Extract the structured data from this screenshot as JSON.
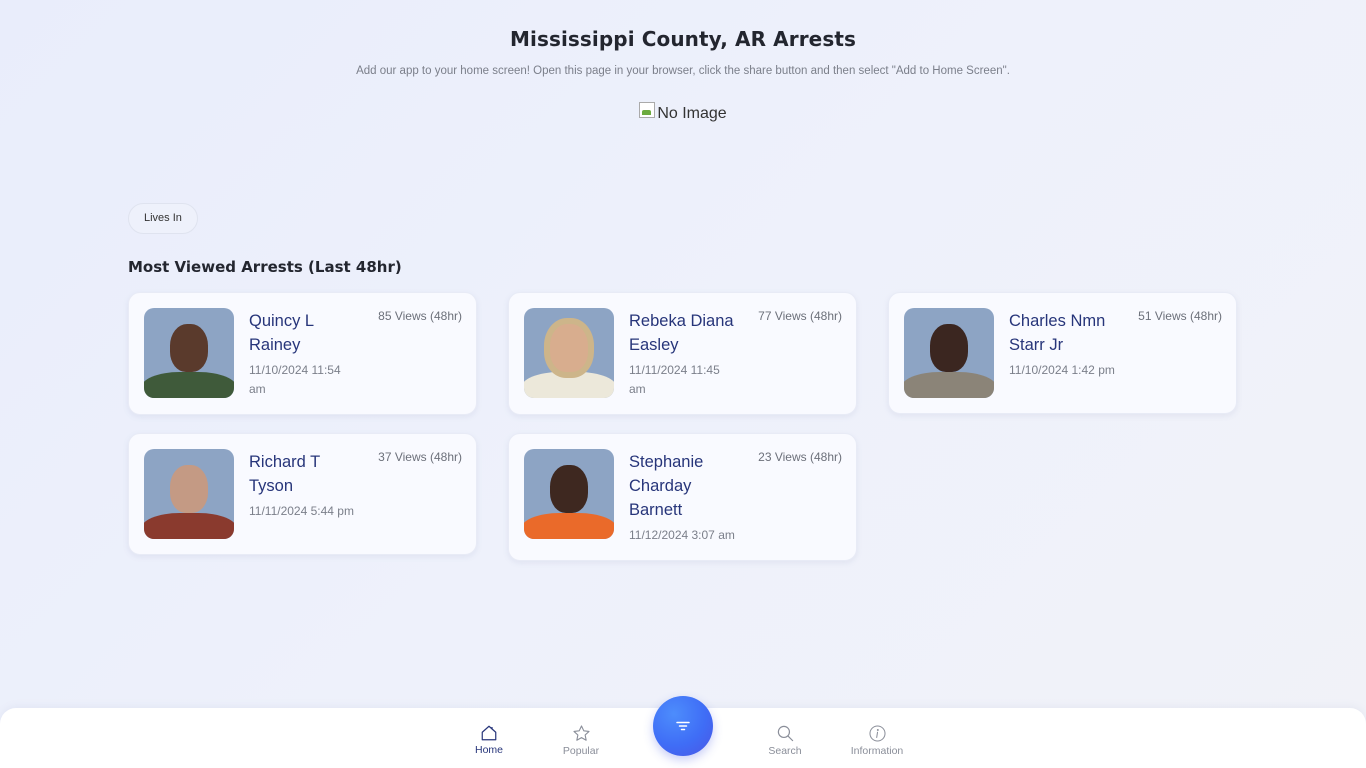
{
  "header": {
    "title": "Mississippi County, AR Arrests",
    "subtitle": "Add our app to your home screen! Open this page in your browser, click the share button and then select \"Add to Home Screen\".",
    "image_alt": "No Image"
  },
  "filters": {
    "chip_label": "Lives In"
  },
  "section": {
    "title": "Most Viewed Arrests (Last 48hr)"
  },
  "arrests": [
    {
      "name": "Quincy L Rainey",
      "datetime": "11/10/2024 11:54 am",
      "views": "85 Views (48hr)",
      "skin": "#5a3a2c",
      "shirt": "#3f5a3a"
    },
    {
      "name": "Rebeka Diana Easley",
      "datetime": "11/11/2024 11:45 am",
      "views": "77 Views (48hr)",
      "skin": "#d8ad8e",
      "shirt": "#ece8da",
      "hair": "#cdb58a"
    },
    {
      "name": "Charles Nmn Starr Jr",
      "datetime": "11/10/2024 1:42 pm",
      "views": "51 Views (48hr)",
      "skin": "#3b2620",
      "shirt": "#8b8478"
    },
    {
      "name": "Richard T Tyson",
      "datetime": "11/11/2024 5:44 pm",
      "views": "37 Views (48hr)",
      "skin": "#c49a84",
      "shirt": "#8a3a2e"
    },
    {
      "name": "Stephanie Charday Barnett",
      "datetime": "11/12/2024 3:07 am",
      "views": "23 Views (48hr)",
      "skin": "#3e2820",
      "shirt": "#ea6a2a"
    }
  ],
  "bottom_nav": {
    "items": [
      {
        "label": "Home",
        "icon": "home-icon",
        "active": true
      },
      {
        "label": "Popular",
        "icon": "star-icon",
        "active": false
      },
      {
        "label": "Search",
        "icon": "search-icon",
        "active": false
      },
      {
        "label": "Information",
        "icon": "info-icon",
        "active": false
      }
    ],
    "fab_icon": "filter-icon"
  },
  "colors": {
    "accent": "#3f6df6",
    "name_text": "#27357a",
    "muted_text": "#7b7f8a"
  }
}
